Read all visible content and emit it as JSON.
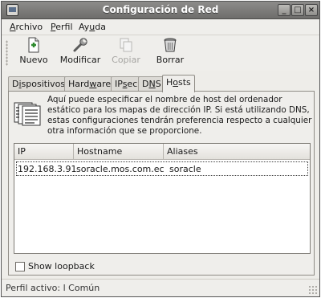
{
  "window": {
    "title": "Configuración de Red",
    "controls": {
      "minimize": "_",
      "maximize": "□",
      "close": "×"
    }
  },
  "menubar": {
    "items": [
      {
        "pre": "",
        "acc": "A",
        "post": "rchivo"
      },
      {
        "pre": "",
        "acc": "P",
        "post": "erfil"
      },
      {
        "pre": "Ay",
        "acc": "u",
        "post": "da"
      }
    ]
  },
  "toolbar": {
    "buttons": [
      {
        "label": "Nuevo",
        "icon": "new-document-icon",
        "enabled": true
      },
      {
        "label": "Modificar",
        "icon": "wrench-icon",
        "enabled": true
      },
      {
        "label": "Copiar",
        "icon": "copy-icon",
        "enabled": false
      },
      {
        "label": "Borrar",
        "icon": "trash-icon",
        "enabled": true
      }
    ]
  },
  "tabs": [
    {
      "pre": "D",
      "acc": "i",
      "post": "spositivos",
      "active": false
    },
    {
      "pre": "Hard",
      "acc": "w",
      "post": "are",
      "active": false
    },
    {
      "pre": "IP",
      "acc": "s",
      "post": "ec",
      "active": false
    },
    {
      "pre": "D",
      "acc": "N",
      "post": "S",
      "active": false
    },
    {
      "pre": "H",
      "acc": "o",
      "post": "sts",
      "active": true
    }
  ],
  "hosts": {
    "description": "Aquí puede especificar el nombre de host del ordenador estático para los mapas de dirección IP. Si está utilizando DNS, estas configuraciones tendrán preferencia respecto a cualquier otra información que se proporcione.",
    "columns": [
      "IP",
      "Hostname",
      "Aliases"
    ],
    "rows": [
      {
        "ip": "192.168.3.91",
        "hostname": "soracle.mos.com.ec",
        "aliases": "soracle"
      }
    ],
    "show_loopback_label": "Show loopback",
    "show_loopback_checked": false
  },
  "statusbar": {
    "text": "Perfil activo: l Común"
  }
}
